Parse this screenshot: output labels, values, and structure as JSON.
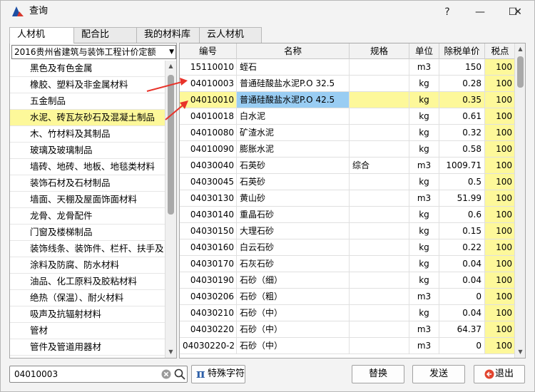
{
  "window": {
    "title": "查询"
  },
  "titlebar_buttons": {
    "help": "?",
    "minimize": "—",
    "maximize": "☐",
    "close": "✕"
  },
  "tabs": [
    {
      "label": "人材机",
      "active": true
    },
    {
      "label": "配合比",
      "active": false
    },
    {
      "label": "我的材料库",
      "active": false
    },
    {
      "label": "云人材机",
      "active": false
    }
  ],
  "quota_combo": {
    "value": "2016贵州省建筑与装饰工程计价定额"
  },
  "categories": [
    {
      "label": "黑色及有色金属",
      "selected": false
    },
    {
      "label": "橡胶、塑料及非金属材料",
      "selected": false
    },
    {
      "label": "五金制品",
      "selected": false
    },
    {
      "label": "水泥、砖瓦灰砂石及混凝土制品",
      "selected": true
    },
    {
      "label": "木、竹材料及其制品",
      "selected": false
    },
    {
      "label": "玻璃及玻璃制品",
      "selected": false
    },
    {
      "label": "墙砖、地砖、地板、地毯类材料",
      "selected": false
    },
    {
      "label": "装饰石材及石材制品",
      "selected": false
    },
    {
      "label": "墙面、天棚及屋面饰面材料",
      "selected": false
    },
    {
      "label": "龙骨、龙骨配件",
      "selected": false
    },
    {
      "label": "门窗及楼梯制品",
      "selected": false
    },
    {
      "label": "装饰线条、装饰件、栏杆、扶手及:",
      "selected": false
    },
    {
      "label": "涂料及防腐、防水材料",
      "selected": false
    },
    {
      "label": "油品、化工原料及胶粘材料",
      "selected": false
    },
    {
      "label": "绝热（保温）、耐火材料",
      "selected": false
    },
    {
      "label": "吸声及抗辐射材料",
      "selected": false
    },
    {
      "label": "管材",
      "selected": false
    },
    {
      "label": "管件及管道用器材",
      "selected": false
    }
  ],
  "grid": {
    "headers": {
      "code": "编号",
      "name": "名称",
      "spec": "规格",
      "unit": "单位",
      "price": "除税单价",
      "tax": "税点"
    },
    "rows": [
      {
        "code": "15110010",
        "name": "蛭石",
        "spec": "",
        "unit": "m3",
        "price": "150",
        "tax": "100",
        "selected": false
      },
      {
        "code": "04010003",
        "name": "普通硅酸盐水泥P.O 32.5",
        "spec": "",
        "unit": "kg",
        "price": "0.28",
        "tax": "100",
        "selected": false
      },
      {
        "code": "04010010",
        "name": "普通硅酸盐水泥P.O 42.5",
        "spec": "",
        "unit": "kg",
        "price": "0.35",
        "tax": "100",
        "selected": true
      },
      {
        "code": "04010018",
        "name": "白水泥",
        "spec": "",
        "unit": "kg",
        "price": "0.61",
        "tax": "100",
        "selected": false
      },
      {
        "code": "04010080",
        "name": "矿渣水泥",
        "spec": "",
        "unit": "kg",
        "price": "0.32",
        "tax": "100",
        "selected": false
      },
      {
        "code": "04010090",
        "name": "膨胀水泥",
        "spec": "",
        "unit": "kg",
        "price": "0.58",
        "tax": "100",
        "selected": false
      },
      {
        "code": "04030040",
        "name": "石英砂",
        "spec": "综合",
        "unit": "m3",
        "price": "1009.71",
        "tax": "100",
        "selected": false
      },
      {
        "code": "04030045",
        "name": "石英砂",
        "spec": "",
        "unit": "kg",
        "price": "0.5",
        "tax": "100",
        "selected": false
      },
      {
        "code": "04030130",
        "name": "黄山砂",
        "spec": "",
        "unit": "m3",
        "price": "51.99",
        "tax": "100",
        "selected": false
      },
      {
        "code": "04030140",
        "name": "重晶石砂",
        "spec": "",
        "unit": "kg",
        "price": "0.6",
        "tax": "100",
        "selected": false
      },
      {
        "code": "04030150",
        "name": "大理石砂",
        "spec": "",
        "unit": "kg",
        "price": "0.15",
        "tax": "100",
        "selected": false
      },
      {
        "code": "04030160",
        "name": "白云石砂",
        "spec": "",
        "unit": "kg",
        "price": "0.22",
        "tax": "100",
        "selected": false
      },
      {
        "code": "04030170",
        "name": "石灰石砂",
        "spec": "",
        "unit": "kg",
        "price": "0.04",
        "tax": "100",
        "selected": false
      },
      {
        "code": "04030190",
        "name": "石砂（细）",
        "spec": "",
        "unit": "kg",
        "price": "0.04",
        "tax": "100",
        "selected": false
      },
      {
        "code": "04030206",
        "name": "石砂（粗）",
        "spec": "",
        "unit": "m3",
        "price": "0",
        "tax": "100",
        "selected": false
      },
      {
        "code": "04030210",
        "name": "石砂（中）",
        "spec": "",
        "unit": "kg",
        "price": "0.04",
        "tax": "100",
        "selected": false
      },
      {
        "code": "04030220",
        "name": "石砂（中）",
        "spec": "",
        "unit": "m3",
        "price": "64.37",
        "tax": "100",
        "selected": false
      },
      {
        "code": "04030220-2",
        "name": "石砂（中）",
        "spec": "",
        "unit": "m3",
        "price": "0",
        "tax": "100",
        "selected": false
      }
    ]
  },
  "search": {
    "value": "04010003",
    "clear_icon": "clear-icon",
    "search_icon": "search-icon"
  },
  "buttons": {
    "special_chars": "特殊字符",
    "special_chars_glyph": "π",
    "replace": "替换",
    "send": "发送",
    "exit": "退出"
  },
  "colors": {
    "selected_row": "#fdf89a",
    "selected_name_cell": "#99cdf3",
    "annotation_arrow": "#e8332a",
    "app_icon_blue": "#1e4fa3",
    "app_icon_red": "#d6362c"
  }
}
